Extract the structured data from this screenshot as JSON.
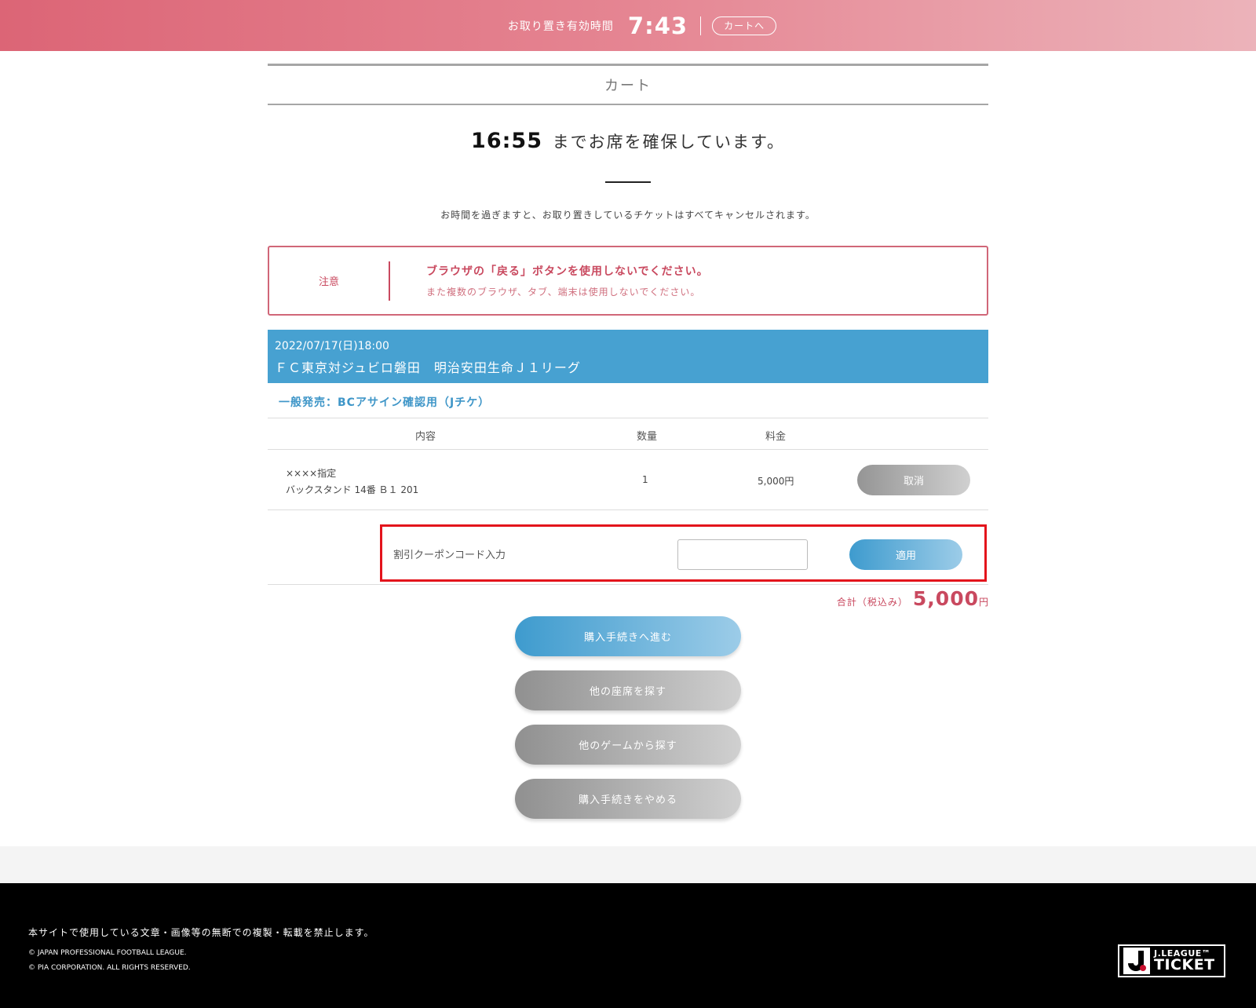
{
  "topbar": {
    "hold_label": "お取り置き有効時間",
    "hold_time": "7:43",
    "cart_link": "カートへ"
  },
  "page": {
    "title": "カート",
    "reserve_time": "16:55",
    "reserve_text": "までお席を確保しています。",
    "cancel_note": "お時間を過ぎますと、お取り置きしているチケットはすべてキャンセルされます。"
  },
  "notice": {
    "label": "注意",
    "main": "ブラウザの「戻る」ボタンを使用しないでください。",
    "sub": "また複数のブラウザ、タブ、端末は使用しないでください。"
  },
  "event": {
    "date": "2022/07/17(日)18:00",
    "title": "ＦＣ東京対ジュビロ磐田　明治安田生命Ｊ１リーグ"
  },
  "sale": {
    "name": "一般発売：BCアサイン確認用（Jチケ）"
  },
  "table": {
    "headers": [
      "内容",
      "数量",
      "料金"
    ],
    "rows": [
      {
        "seat_type": "××××指定",
        "seat_location": "バックスタンド 14番 Ｂ１ 201",
        "quantity": "1",
        "price": "5,000円",
        "cancel_label": "取消"
      }
    ]
  },
  "coupon": {
    "label": "割引クーポンコード入力",
    "value": "",
    "apply_label": "適用"
  },
  "total": {
    "label": "合計（税込み）",
    "amount": "5,000",
    "unit": "円"
  },
  "actions": {
    "proceed": "購入手続きへ進む",
    "other_seats": "他の座席を探す",
    "other_games": "他のゲームから探す",
    "quit": "購入手続きをやめる"
  },
  "footer": {
    "notice": "本サイトで使用している文章・画像等の無断での複製・転載を禁止します。",
    "copyright_1": "© JAPAN PROFESSIONAL FOOTBALL LEAGUE.",
    "copyright_2": "© PIA CORPORATION. ALL RIGHTS RESERVED.",
    "logo_top": "J.LEAGUE™",
    "logo_bottom": "TICKET"
  },
  "colors": {
    "accent_pink": "#c9495f",
    "accent_blue": "#47a1d1",
    "topbar_start": "#dc6576",
    "coupon_highlight": "#e3141c"
  }
}
